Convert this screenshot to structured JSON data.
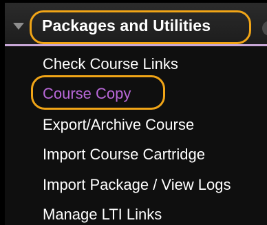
{
  "panel": {
    "title": "Packages and Utilities",
    "caret_icon": "triangle-down-icon",
    "items": [
      {
        "label": "Check Course Links"
      },
      {
        "label": "Course Copy",
        "state": "active"
      },
      {
        "label": "Export/Archive Course"
      },
      {
        "label": "Import Course Cartridge"
      },
      {
        "label": "Import Package / View Logs"
      },
      {
        "label": "Manage LTI Links"
      }
    ]
  },
  "colors": {
    "panel_background": "#0f0f0f",
    "header_background": "#2b2b2b",
    "header_divider": "#c9a8d8",
    "text": "#ffffff",
    "active_link": "#b968d9",
    "highlight_ring": "#f1a517"
  }
}
